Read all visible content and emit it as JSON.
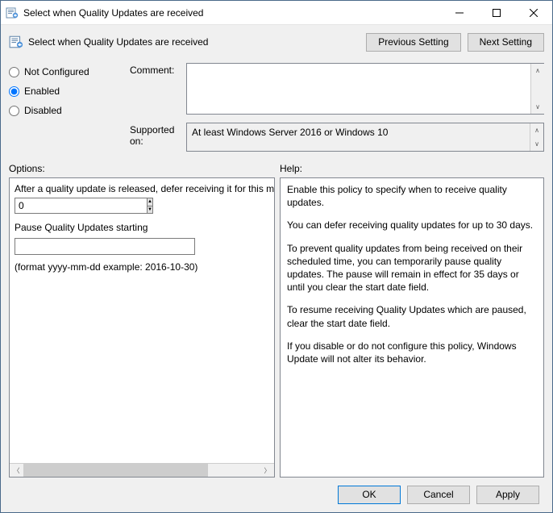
{
  "window": {
    "title": "Select when Quality Updates are received"
  },
  "header": {
    "title": "Select when Quality Updates are received",
    "prev_btn": "Previous Setting",
    "next_btn": "Next Setting"
  },
  "state": {
    "radios": {
      "not_configured": "Not Configured",
      "enabled": "Enabled",
      "disabled": "Disabled",
      "selected": "enabled"
    },
    "comment_label": "Comment:",
    "comment_value": "",
    "supported_label": "Supported on:",
    "supported_value": "At least Windows Server 2016 or Windows 10"
  },
  "labels": {
    "options": "Options:",
    "help": "Help:"
  },
  "options": {
    "defer_label": "After a quality update is released, defer receiving it for this many days:",
    "defer_value": "0",
    "pause_label": "Pause Quality Updates starting",
    "pause_value": "",
    "format_hint": "(format yyyy-mm-dd example: 2016-10-30)"
  },
  "help": {
    "p1": "Enable this policy to specify when to receive quality updates.",
    "p2": "You can defer receiving quality updates for up to 30 days.",
    "p3": "To prevent quality updates from being received on their scheduled time, you can temporarily pause quality updates. The pause will remain in effect for 35 days or until you clear the start date field.",
    "p4": "To resume receiving Quality Updates which are paused, clear the start date field.",
    "p5": "If you disable or do not configure this policy, Windows Update will not alter its behavior."
  },
  "footer": {
    "ok": "OK",
    "cancel": "Cancel",
    "apply": "Apply"
  }
}
